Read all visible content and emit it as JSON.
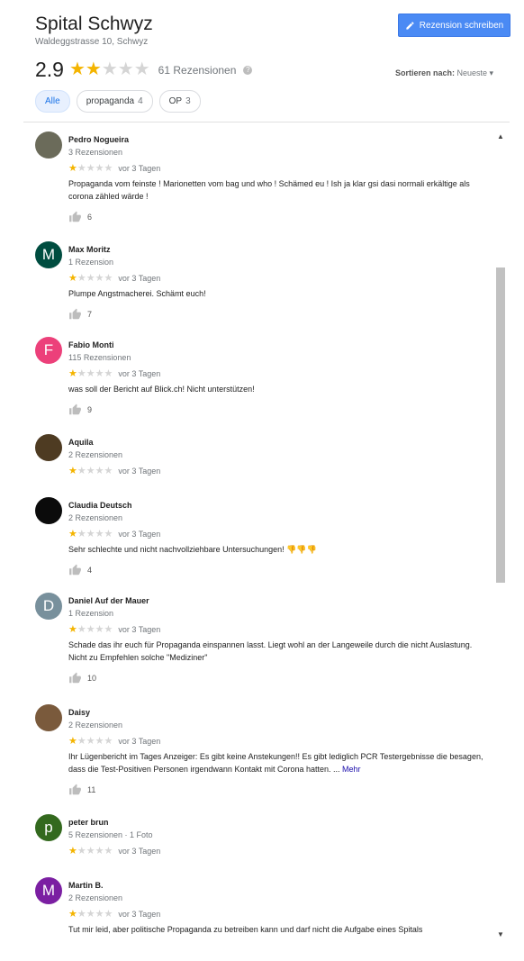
{
  "place": {
    "title": "Spital Schwyz",
    "address": "Waldeggstrasse 10, Schwyz",
    "write_review_label": "Rezension schreiben",
    "rating": "2.9",
    "rating_value": 2.9,
    "review_count": "61 Rezensionen",
    "help_glyph": "?",
    "sort_label": "Sortieren nach:",
    "sort_value": "Neueste ▾"
  },
  "filters": [
    {
      "label": "Alle",
      "count": ""
    },
    {
      "label": "propaganda",
      "count": "4"
    },
    {
      "label": "OP",
      "count": "3"
    }
  ],
  "reviews": [
    {
      "name": "Pedro Nogueira",
      "meta": "3 Rezensionen",
      "rating": 1,
      "time": "vor 3 Tagen",
      "text": "Propaganda vom feinste ! Marionetten vom bag und who ! Schämed eu ! Ish ja klar gsi dasi normali erkältige als corona zähled wärde !",
      "likes": "6",
      "initial": "",
      "avatar_color": "#6b6b5a"
    },
    {
      "name": "Max Moritz",
      "meta": "1 Rezension",
      "rating": 1,
      "time": "vor 3 Tagen",
      "text": "Plumpe Angstmacherei. Schämt euch!",
      "likes": "7",
      "initial": "M",
      "avatar_color": "#004d40"
    },
    {
      "name": "Fabio Monti",
      "meta": "115 Rezensionen",
      "rating": 1,
      "time": "vor 3 Tagen",
      "text": "was soll der Bericht auf Blick.ch! Nicht unterstützen!",
      "likes": "9",
      "initial": "F",
      "avatar_color": "#ec407a"
    },
    {
      "name": "Aquila",
      "meta": "2 Rezensionen",
      "rating": 1,
      "time": "vor 3 Tagen",
      "text": "",
      "likes": "",
      "initial": "",
      "avatar_color": "#4e3b22"
    },
    {
      "name": "Claudia Deutsch",
      "meta": "2 Rezensionen",
      "rating": 1,
      "time": "vor 3 Tagen",
      "text": "Sehr schlechte und nicht nachvollziehbare Untersuchungen! 👎👎👎",
      "likes": "4",
      "initial": "",
      "avatar_color": "#0b0b0b"
    },
    {
      "name": "Daniel Auf der Mauer",
      "meta": "1 Rezension",
      "rating": 1,
      "time": "vor 3 Tagen",
      "text": "Schade das ihr euch für Propaganda einspannen lasst. Liegt wohl an der Langeweile durch die nicht Auslastung. Nicht zu Empfehlen solche \"Mediziner\"",
      "likes": "10",
      "initial": "D",
      "avatar_color": "#78909c"
    },
    {
      "name": "Daisy",
      "meta": "2 Rezensionen",
      "rating": 1,
      "time": "vor 3 Tagen",
      "text": "Ihr Lügenbericht im Tages Anzeiger: Es gibt keine Anstekungen!! Es gibt lediglich PCR Testergebnisse die besagen, dass die Test-Positiven Personen irgendwann Kontakt mit Corona hatten. ...",
      "more": "Mehr",
      "likes": "11",
      "initial": "",
      "avatar_color": "#7a5a3c"
    },
    {
      "name": "peter brun",
      "meta": "5 Rezensionen · 1 Foto",
      "rating": 1,
      "time": "vor 3 Tagen",
      "text": "",
      "likes": "",
      "initial": "p",
      "avatar_color": "#33691e"
    },
    {
      "name": "Martin B.",
      "meta": "2 Rezensionen",
      "rating": 1,
      "time": "vor 3 Tagen",
      "text": "Tut mir leid, aber politische Propaganda zu betreiben kann und darf nicht die Aufgabe eines Spitals",
      "likes": "",
      "initial": "M",
      "avatar_color": "#7b1fa2"
    }
  ],
  "colors": {
    "accent": "#4a8af4",
    "star": "#f4b400",
    "star_empty": "#d5d5d5"
  },
  "icons": {
    "write": "pencil-icon",
    "like": "thumbs-up-icon"
  }
}
